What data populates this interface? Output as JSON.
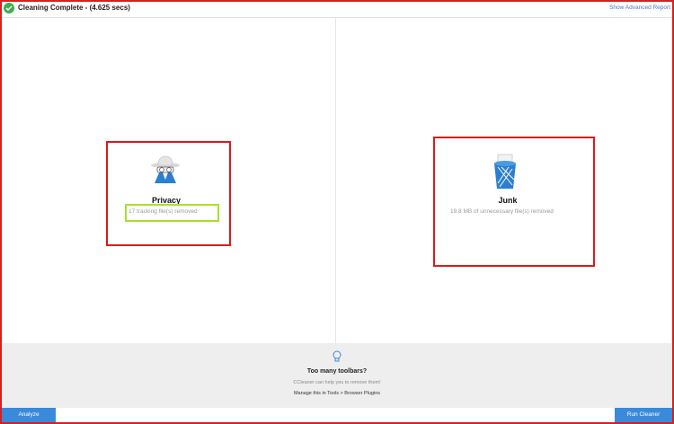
{
  "header": {
    "status_icon": "check-circle-icon",
    "title": "Cleaning Complete - (4.625 secs)",
    "advanced_report_link": "Show Advanced Report"
  },
  "results": [
    {
      "icon": "spy-icon",
      "title": "Privacy",
      "description": "17 tracking file(s) removed"
    },
    {
      "icon": "recycle-bin-icon",
      "title": "Junk",
      "description": "19.8 MB of unnecessary file(s) removed"
    }
  ],
  "promo": {
    "icon": "lightbulb-icon",
    "title": "Too many toolbars?",
    "subtitle": "CCleaner can help you to remove them!",
    "link": "Manage this in Tools > Browser Plugins"
  },
  "buttons": {
    "analyze": "Analyze",
    "run": "Run Cleaner"
  },
  "colors": {
    "accent": "#3b8ad9",
    "success": "#3fae52",
    "annotation_red": "#d91c1c",
    "annotation_green": "#a6e22e"
  }
}
